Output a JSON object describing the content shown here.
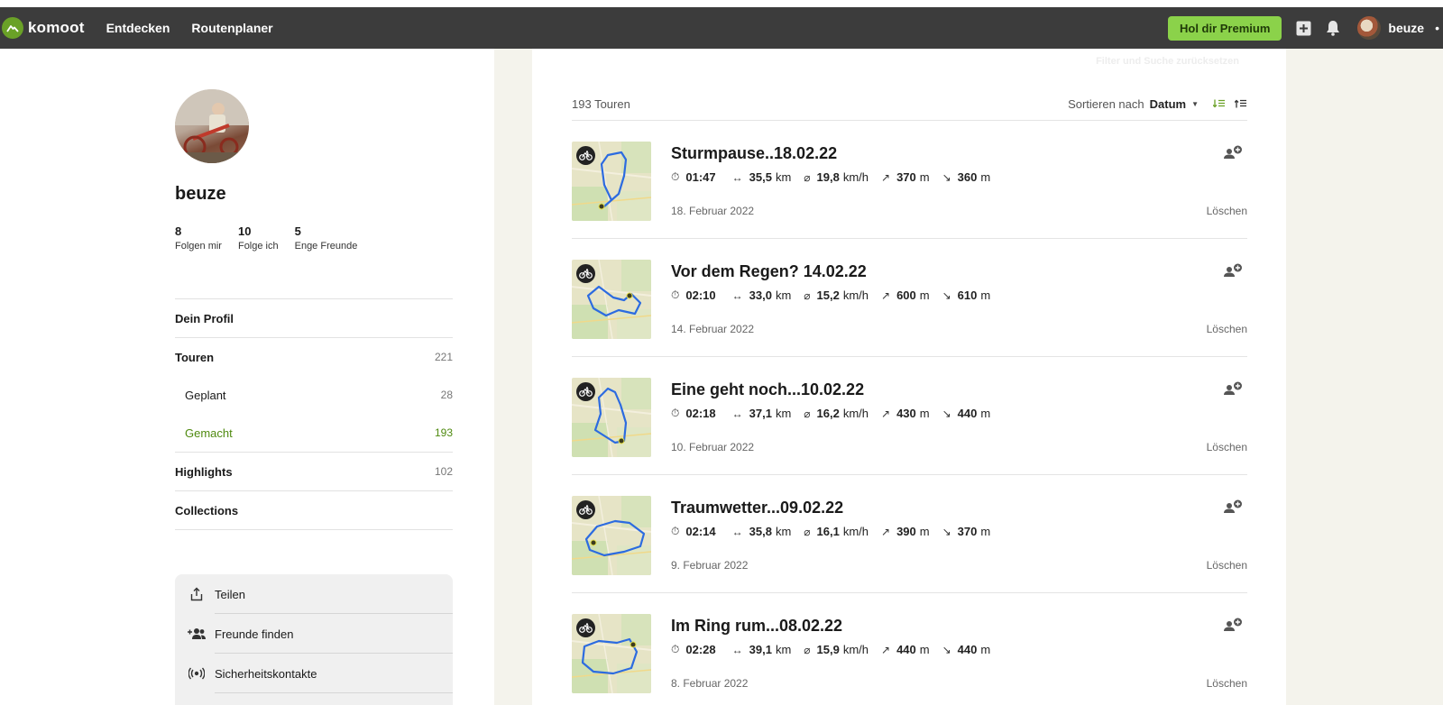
{
  "nav": {
    "brand": "komoot",
    "links": [
      "Entdecken",
      "Routenplaner"
    ],
    "premium": "Hol dir Premium",
    "user": "beuze",
    "more": "•",
    "icons": [
      "add-icon",
      "bell-icon"
    ]
  },
  "profile": {
    "name": "beuze",
    "stats": [
      {
        "num": "8",
        "label": "Folgen mir"
      },
      {
        "num": "10",
        "label": "Folge ich"
      },
      {
        "num": "5",
        "label": "Enge Freunde"
      }
    ],
    "menu": {
      "profile": "Dein Profil",
      "tours": {
        "label": "Touren",
        "count": "221"
      },
      "planned": {
        "label": "Geplant",
        "count": "28"
      },
      "done": {
        "label": "Gemacht",
        "count": "193"
      },
      "highlights": {
        "label": "Highlights",
        "count": "102"
      },
      "collections": "Collections"
    },
    "actions": [
      "Teilen",
      "Freunde finden",
      "Sicherheitskontakte"
    ]
  },
  "list": {
    "filter_reset": "Filter und Suche zurücksetzen",
    "count": "193 Touren",
    "sort_label": "Sortieren nach",
    "sort_value": "Datum",
    "delete_label": "Löschen",
    "units": {
      "distance": "km",
      "speed": "km/h",
      "elevation": "m"
    },
    "tours": [
      {
        "title": "Sturmpause..18.02.22",
        "duration": "01:47",
        "distance": "35,5",
        "speed": "19,8",
        "up": "370",
        "down": "360",
        "date": "18. Februar 2022"
      },
      {
        "title": "Vor dem Regen? 14.02.22",
        "duration": "02:10",
        "distance": "33,0",
        "speed": "15,2",
        "up": "600",
        "down": "610",
        "date": "14. Februar 2022"
      },
      {
        "title": "Eine geht noch...10.02.22",
        "duration": "02:18",
        "distance": "37,1",
        "speed": "16,2",
        "up": "430",
        "down": "440",
        "date": "10. Februar 2022"
      },
      {
        "title": "Traumwetter...09.02.22",
        "duration": "02:14",
        "distance": "35,8",
        "speed": "16,1",
        "up": "390",
        "down": "370",
        "date": "9. Februar 2022"
      },
      {
        "title": "Im Ring rum...08.02.22",
        "duration": "02:28",
        "distance": "39,1",
        "speed": "15,9",
        "up": "440",
        "down": "440",
        "date": "8. Februar 2022"
      }
    ]
  },
  "colors": {
    "accent": "#6aa127",
    "premium": "#8bd24a",
    "navbar": "#3c3c3c",
    "active": "#4f8a10"
  }
}
